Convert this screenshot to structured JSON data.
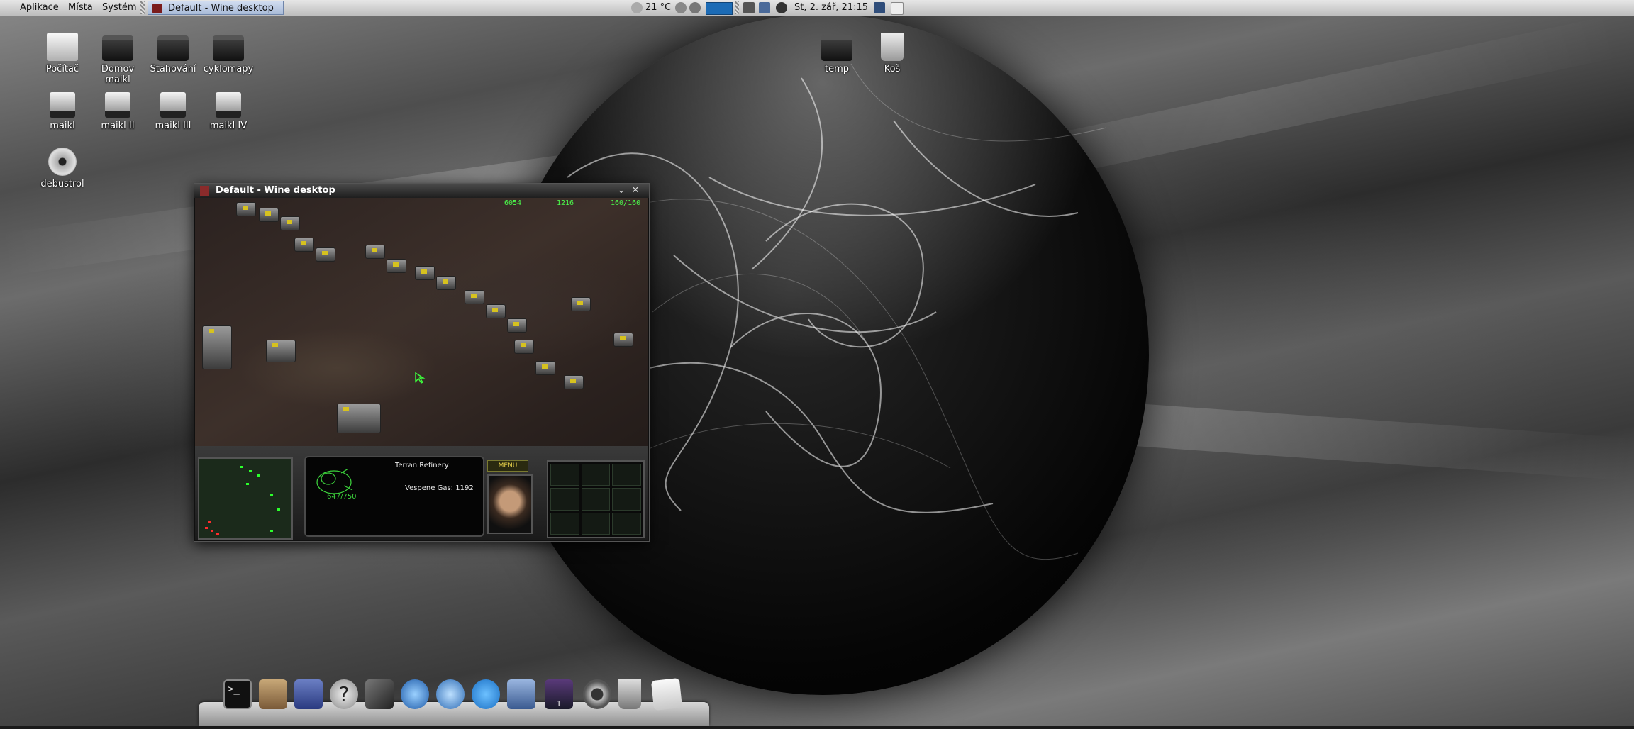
{
  "top_panel": {
    "menus": [
      "Aplikace",
      "Místa",
      "Systém"
    ],
    "taskbar_item": "Default - Wine desktop",
    "weather": "21 °C",
    "clock": "St,  2. zář, 21:15"
  },
  "desktop_icons": [
    {
      "label": "Počítač",
      "icon": "computer-icon"
    },
    {
      "label": "Domov maikl",
      "icon": "home-folder-icon"
    },
    {
      "label": "Stahování",
      "icon": "downloads-folder-icon"
    },
    {
      "label": "cyklomapy",
      "icon": "folder-icon"
    },
    {
      "label": "maikl",
      "icon": "drive-icon"
    },
    {
      "label": "maikl II",
      "icon": "drive-icon"
    },
    {
      "label": "maikl III",
      "icon": "drive-icon"
    },
    {
      "label": "maikl IV",
      "icon": "drive-icon"
    },
    {
      "label": "debustrol",
      "icon": "disc-icon"
    },
    {
      "label": "temp",
      "icon": "folder-icon"
    },
    {
      "label": "Koš",
      "icon": "trash-icon"
    }
  ],
  "window": {
    "title": "Default - Wine desktop",
    "game": {
      "minerals": "6054",
      "gas": "1216",
      "supply": "160/160",
      "selected_unit": "Terran Refinery",
      "resource_line": "Vespene Gas: 1192",
      "hp": "647/750",
      "menu_label": "MENU"
    }
  },
  "dock_icons": [
    "terminal-icon",
    "package-icon",
    "floppy-icon",
    "help-icon",
    "tools-icon",
    "browser-icon",
    "globe-icon",
    "video-chat-icon",
    "pen-icon",
    "workspace-switcher-icon",
    "media-icon",
    "trash-icon",
    "paper-icon"
  ],
  "workspace_number": "1"
}
